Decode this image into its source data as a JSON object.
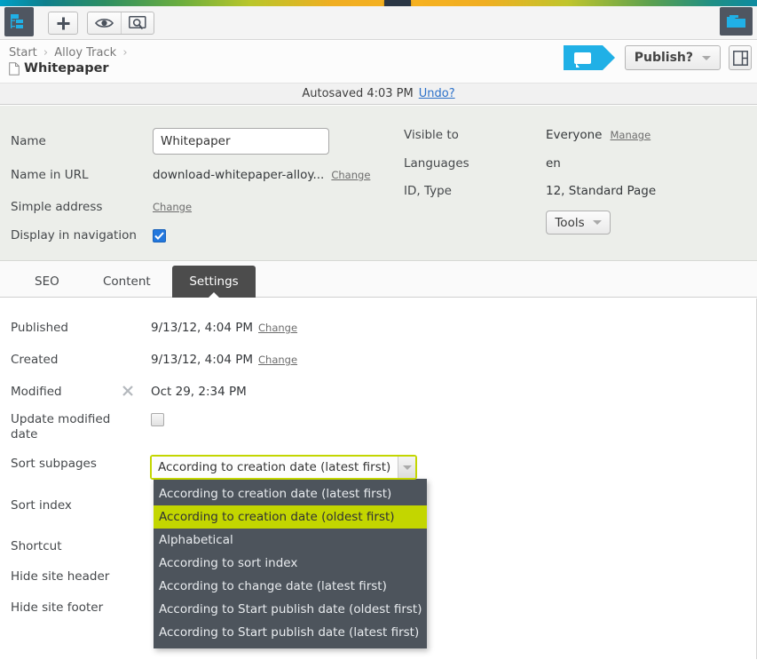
{
  "colors": {
    "accent_green": "#c3d600",
    "accent_blue": "#20b0e6",
    "tile_dark": "#4f5661",
    "dropdown_bg": "#4d545c",
    "tab_active": "#4c4c4c",
    "summary_bg": "#eceeea",
    "link_blue": "#2b70c9"
  },
  "global_toolbar": {
    "tree_icon": "sitemap-icon",
    "add_label": "+",
    "add_icon": "plus-icon",
    "view_icon": "eye-icon",
    "preview_icon": "preview-search-icon",
    "folder_icon": "folder-icon",
    "pull_tab_icon": "chevron-down-icon"
  },
  "breadcrumb": {
    "items": [
      {
        "label": "Start"
      },
      {
        "label": "Alloy Track"
      }
    ],
    "separator": "›",
    "page_icon": "page-icon",
    "page_title": "Whitepaper"
  },
  "header_actions": {
    "comment_icon": "speech-bubble-icon",
    "publish_label": "Publish?",
    "publish_caret_icon": "chevron-down-icon",
    "panel_toggle_icon": "panel-layout-icon"
  },
  "autosave": {
    "text": "Autosaved 4:03 PM",
    "undo_label": "Undo?"
  },
  "summary": {
    "left": [
      {
        "label": "Name",
        "type": "input",
        "value": "Whitepaper",
        "placeholder": ""
      },
      {
        "label": "Name in URL",
        "type": "text-link",
        "value": "download-whitepaper-alloy...",
        "link": "Change"
      },
      {
        "label": "Simple address",
        "type": "link-only",
        "value": "",
        "link": "Change"
      },
      {
        "label": "Display in navigation",
        "type": "checkbox",
        "checked": true
      }
    ],
    "right": [
      {
        "label": "Visible to",
        "value": "Everyone",
        "link": "Manage"
      },
      {
        "label": "Languages",
        "value": "en",
        "link": ""
      },
      {
        "label": "ID, Type",
        "value": "12, Standard Page",
        "link": ""
      }
    ],
    "tools_label": "Tools",
    "tools_caret_icon": "chevron-down-icon"
  },
  "tabs": [
    {
      "label": "SEO",
      "active": false
    },
    {
      "label": "Content",
      "active": false
    },
    {
      "label": "Settings",
      "active": true
    }
  ],
  "settings": {
    "rows": [
      {
        "label": "Published",
        "value": "9/13/12, 4:04 PM",
        "link": "Change",
        "icon": ""
      },
      {
        "label": "Created",
        "value": "9/13/12, 4:04 PM",
        "link": "Change",
        "icon": ""
      },
      {
        "label": "Modified",
        "value": "Oct 29, 2:34 PM",
        "link": "",
        "icon": "unlink-icon"
      },
      {
        "label": "Update modified date",
        "value": "",
        "link": "",
        "icon": "",
        "checkbox": false
      },
      {
        "label": "Sort subpages",
        "value": "",
        "link": "",
        "icon": ""
      },
      {
        "label": "Sort index",
        "value": "",
        "link": "",
        "icon": ""
      },
      {
        "label": "Shortcut",
        "value": "",
        "link": "",
        "icon": ""
      },
      {
        "label": "Hide site header",
        "value": "",
        "link": "",
        "icon": ""
      },
      {
        "label": "Hide site footer",
        "value": "",
        "link": "",
        "icon": ""
      }
    ]
  },
  "sort_subpages_select": {
    "selected_label": "According to creation date (latest first)",
    "arrow_icon": "chevron-down-icon",
    "expanded": true,
    "options": [
      {
        "label": "According to creation date (latest first)",
        "highlighted": false
      },
      {
        "label": "According to creation date (oldest first)",
        "highlighted": true
      },
      {
        "label": "Alphabetical",
        "highlighted": false
      },
      {
        "label": "According to sort index",
        "highlighted": false
      },
      {
        "label": "According to change date (latest first)",
        "highlighted": false
      },
      {
        "label": "According to Start publish date (oldest first)",
        "highlighted": false
      },
      {
        "label": "According to Start publish date (latest first)",
        "highlighted": false
      }
    ]
  }
}
